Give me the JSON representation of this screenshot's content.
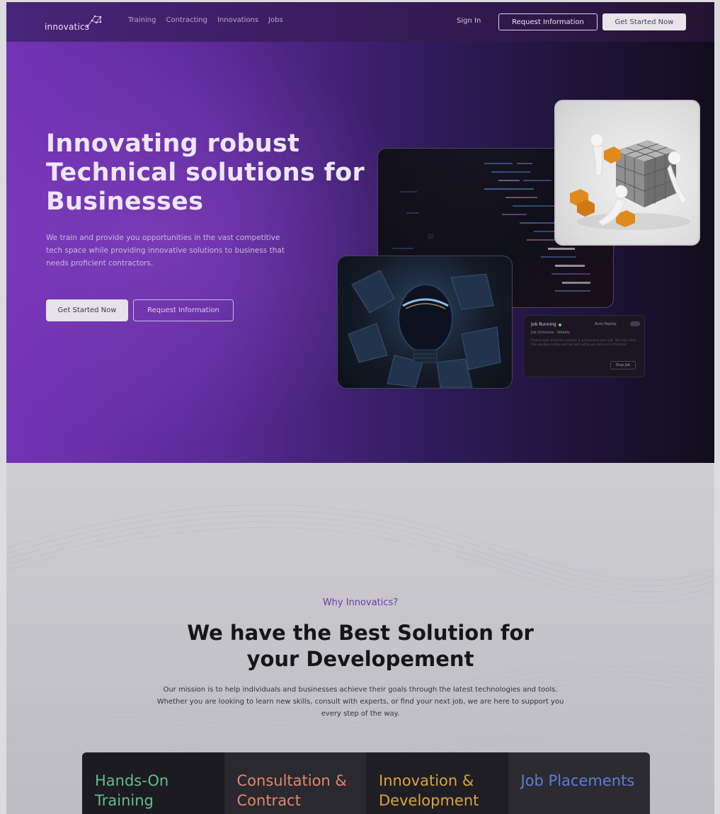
{
  "nav": {
    "logo": "innovatics",
    "links": [
      "Training",
      "Contracting",
      "Innovations",
      "Jobs"
    ],
    "sign_in": "Sign In",
    "request_info": "Request Information",
    "get_started": "Get Started Now"
  },
  "hero": {
    "title": "Innovating robust Technical solutions for Businesses",
    "description": "We train and provide you opportunities in the vast competitive tech space while providing innovative solutions to business that needs proficient contractors.",
    "cta_primary": "Get Started Now",
    "cta_secondary": "Request Information",
    "job_card": {
      "status": "Job Running",
      "toggle_label": "Auto Deploy",
      "subtitle": "Job Schedule · Weekly",
      "body": "Please wait while the system is processing your job. You can close this window safely and we will notify you when it is finished.",
      "stop_label": "Stop Job"
    }
  },
  "why": {
    "eyebrow": "Why Innovatics?",
    "title": "We have the Best Solution for your Developement",
    "description": "Our mission is to help individuals and businesses achieve their goals through the latest technologies and tools. Whether you are looking to learn new skills, consult with experts, or find your next job, we are here to support you every step of the way.",
    "cards": [
      {
        "label": "Hands-On Training",
        "color": "#5fbf8c",
        "bg": "#1c1b22"
      },
      {
        "label": "Consultation & Contract",
        "color": "#e0876a",
        "bg": "#2a292f"
      },
      {
        "label": "Innovation & Development",
        "color": "#d9a53a",
        "bg": "#1f1e24"
      },
      {
        "label": "Job Placements",
        "color": "#5a7fd6",
        "bg": "#2c2b31"
      }
    ]
  },
  "colors": {
    "accent": "#6a3bb0",
    "hero_start": "#7433b6",
    "hero_end": "#120d1c"
  }
}
